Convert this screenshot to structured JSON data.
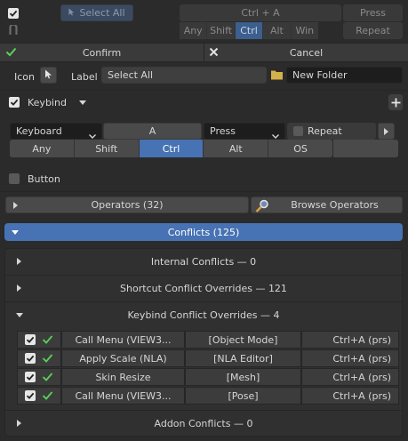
{
  "top": {
    "select_all": "Select All",
    "combo": "Ctrl + A",
    "mod_keys": [
      "Any",
      "Shift",
      "Ctrl",
      "Alt",
      "Win"
    ],
    "active_mod": "Ctrl",
    "press": "Press",
    "repeat": "Repeat"
  },
  "actions": {
    "confirm": "Confirm",
    "cancel": "Cancel"
  },
  "icon_row": {
    "icon_label": "Icon",
    "label_label": "Label",
    "label_value": "Select All",
    "folder_value": "New Folder"
  },
  "keybind": {
    "title": "Keybind",
    "device": "Keyboard",
    "key": "A",
    "event": "Press",
    "repeat": "Repeat",
    "mods": [
      "Any",
      "Shift",
      "Ctrl",
      "Alt",
      "OS"
    ],
    "active_mod": "Ctrl"
  },
  "button_label": "Button",
  "operators": {
    "label": "Operators (32)",
    "browse": "Browse Operators"
  },
  "conflicts": {
    "title": "Conflicts (125)",
    "internal": "Internal Conflicts — 0",
    "shortcut": "Shortcut Conflict Overrides — 121",
    "keybind": "Keybind Conflict Overrides — 4",
    "addon": "Addon Conflicts — 0",
    "rows": [
      {
        "name": "Call Menu (VIEW3...",
        "context": "[Object Mode]",
        "key": "Ctrl+A (prs)"
      },
      {
        "name": "Apply Scale (NLA)",
        "context": "[NLA Editor]",
        "key": "Ctrl+A (prs)"
      },
      {
        "name": "Skin Resize",
        "context": "[Mesh]",
        "key": "Ctrl+A (prs)"
      },
      {
        "name": "Call Menu (VIEW3...",
        "context": "[Pose]",
        "key": "Ctrl+A (prs)"
      }
    ]
  },
  "colors": {
    "accent": "#4772b3",
    "check_green": "#5ad15a"
  }
}
